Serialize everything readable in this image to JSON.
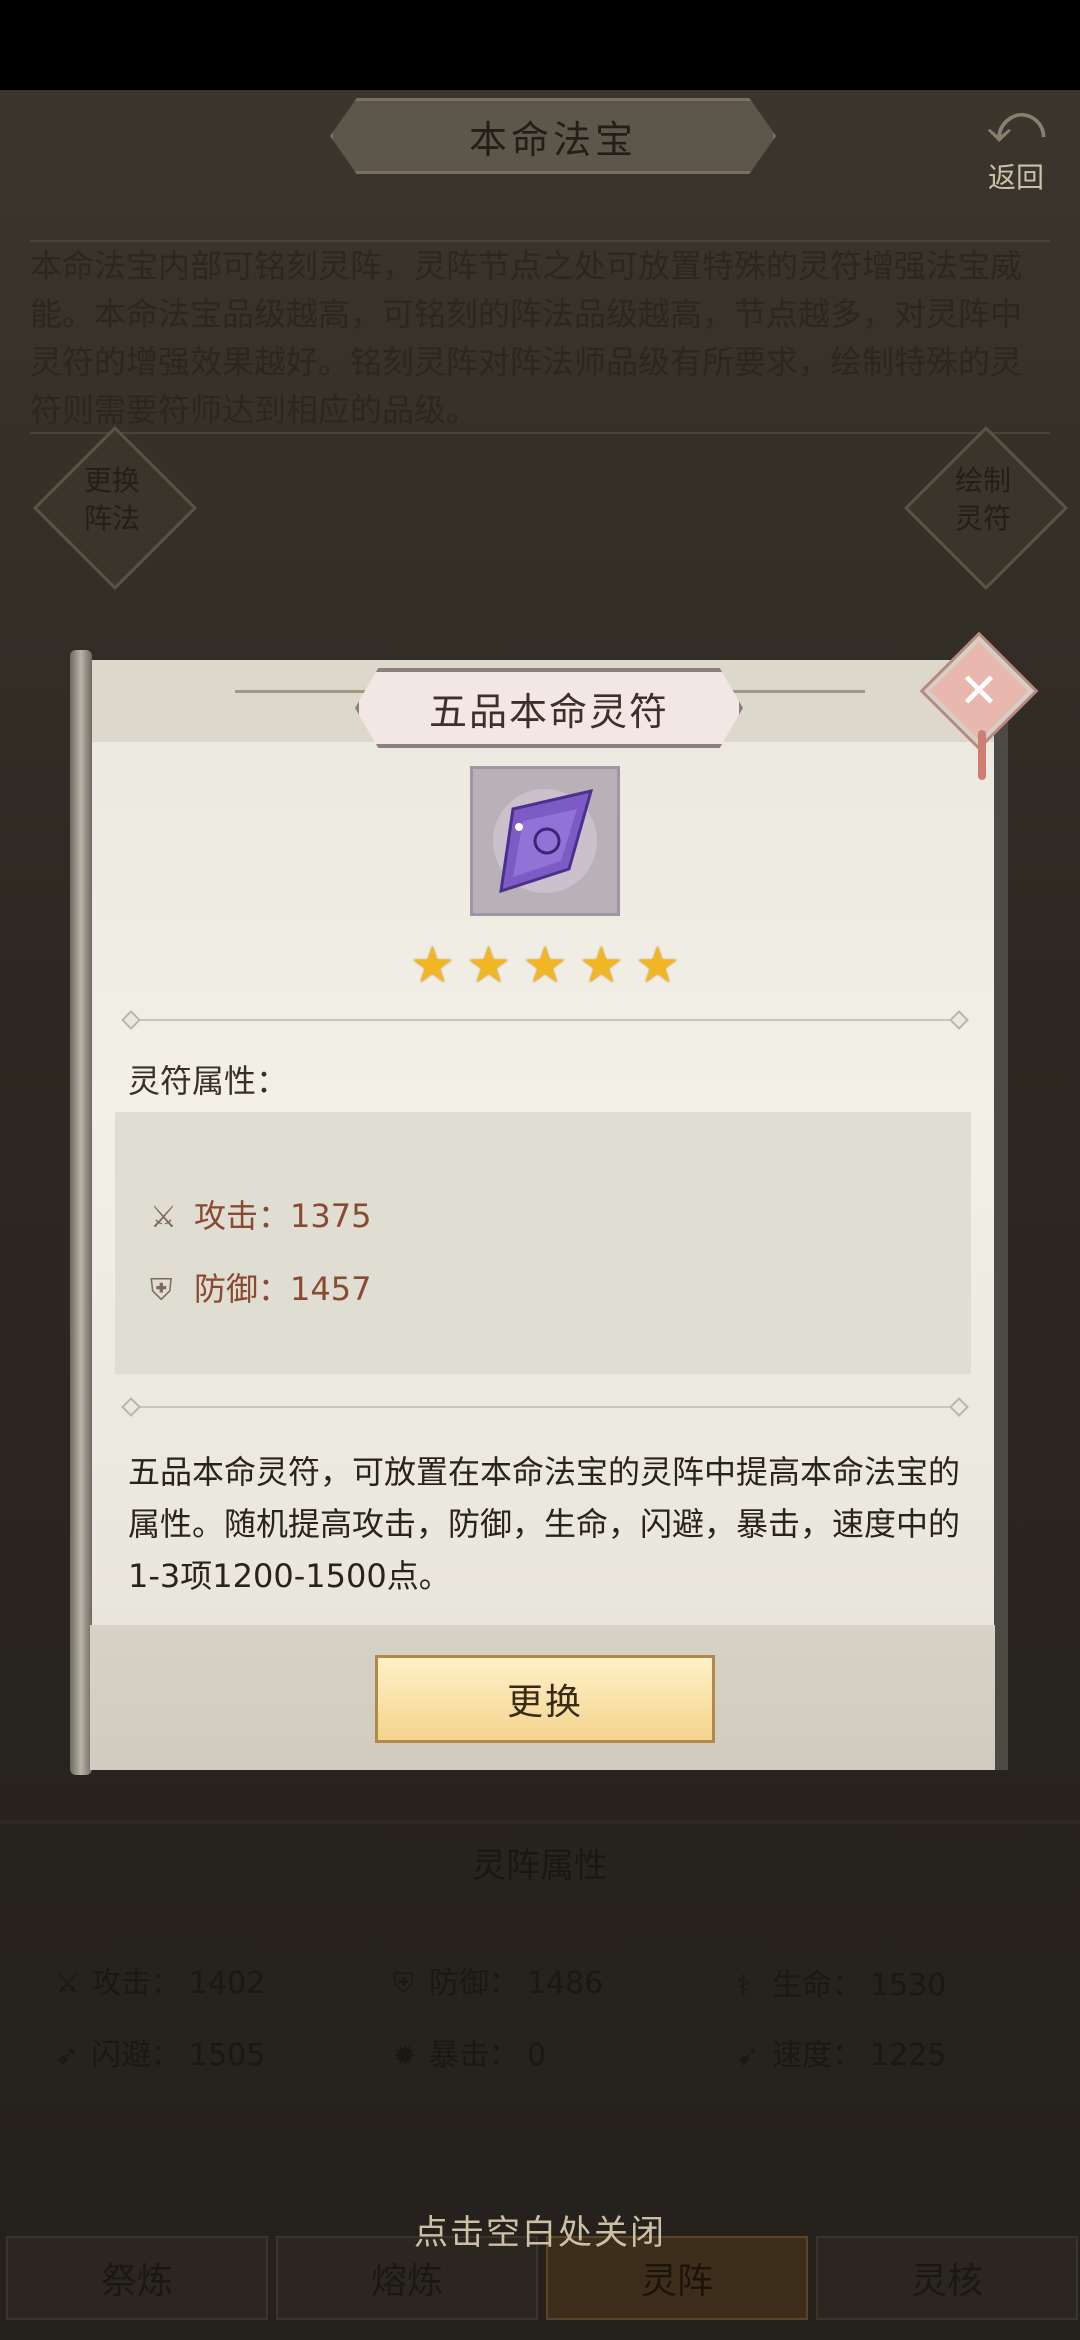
{
  "page": {
    "title": "本命法宝",
    "back_label": "返回",
    "description": "本命法宝内部可铭刻灵阵，灵阵节点之处可放置特殊的灵符增强法宝威能。本命法宝品级越高，可铭刻的阵法品级越高，节点越多，对灵阵中灵符的增强效果越好。铭刻灵阵对阵法师品级有所要求，绘制特殊的灵符则需要符师达到相应的品级。",
    "left_button": [
      "更换",
      "阵法"
    ],
    "right_button": [
      "绘制",
      "灵符"
    ]
  },
  "array_attributes": {
    "title": "灵阵属性",
    "items": [
      {
        "icon": "sword-icon",
        "label": "攻击：",
        "value": "1402"
      },
      {
        "icon": "shield-icon",
        "label": "防御：",
        "value": "1486"
      },
      {
        "icon": "life-icon",
        "label": "生命：",
        "value": "1530"
      },
      {
        "icon": "dodge-icon",
        "label": "闪避：",
        "value": "1505"
      },
      {
        "icon": "crit-icon",
        "label": "暴击：",
        "value": "0"
      },
      {
        "icon": "speed-icon",
        "label": "速度：",
        "value": "1225"
      }
    ]
  },
  "close_hint": "点击空白处关闭",
  "bottom_tabs": [
    {
      "label": "祭炼",
      "active": false
    },
    {
      "label": "熔炼",
      "active": false
    },
    {
      "label": "灵阵",
      "active": true
    },
    {
      "label": "灵核",
      "active": false
    }
  ],
  "modal": {
    "title": "五品本命灵符",
    "stars": 5,
    "section_label": "灵符属性：",
    "stats": [
      {
        "icon": "sword-icon",
        "label": "攻击：",
        "value": "1375"
      },
      {
        "icon": "shield-icon",
        "label": "防御：",
        "value": "1457"
      }
    ],
    "description": "五品本命灵符，可放置在本命法宝的灵阵中提高本命法宝的属性。随机提高攻击，防御，生命，闪避，暴击，速度中的1-3项1200-1500点。",
    "action_label": "更换"
  },
  "colors": {
    "star": "#f2b624",
    "stat_text": "#8a4a31",
    "button_fill": "#f4d48e"
  }
}
